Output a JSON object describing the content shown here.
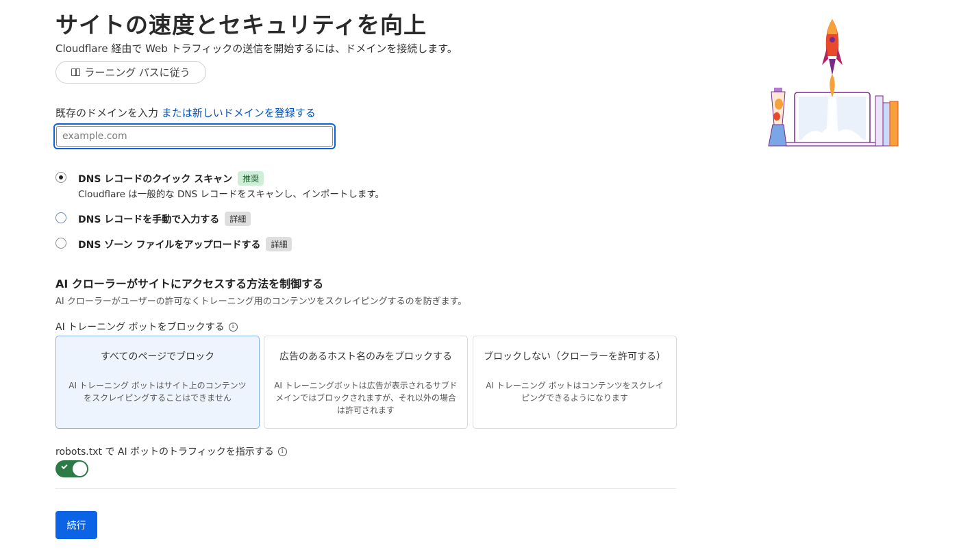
{
  "header": {
    "title": "サイトの速度とセキュリティを向上",
    "subtitle": "Cloudflare 経由で Web トラフィックの送信を開始するには、ドメインを接続します。",
    "learning_path_label": "ラーニング パスに従う"
  },
  "domain": {
    "label": "既存のドメインを入力",
    "register_link": "または新しいドメインを登録する",
    "placeholder": "example.com",
    "value": ""
  },
  "dns_options": [
    {
      "title": "DNS レコードのクイック スキャン",
      "badge": "推奨",
      "description": "Cloudflare は一般的な DNS レコードをスキャンし、インポートします。",
      "selected": true
    },
    {
      "title": "DNS レコードを手動で入力する",
      "badge": "詳細",
      "selected": false
    },
    {
      "title": "DNS ゾーン ファイルをアップロードする",
      "badge": "詳細",
      "selected": false
    }
  ],
  "ai_crawlers": {
    "title": "AI クローラーがサイトにアクセスする方法を制御する",
    "description": "AI クローラーがユーザーの許可なくトレーニング用のコンテンツをスクレイピングするのを防ぎます。",
    "block_label": "AI トレーニング ボットをブロックする",
    "cards": [
      {
        "title": "すべてのページでブロック",
        "description": "AI トレーニング ボットはサイト上のコンテンツをスクレイピングすることはできません",
        "selected": true
      },
      {
        "title": "広告のあるホスト名のみをブロックする",
        "description": "AI トレーニングボットは広告が表示されるサブドメインではブロックされますが、それ以外の場合は許可されます",
        "selected": false
      },
      {
        "title": "ブロックしない（クローラーを許可する）",
        "description": "AI トレーニング ボットはコンテンツをスクレイピングできるようになります",
        "selected": false
      }
    ],
    "robots_label": "robots.txt で AI ボットのトラフィックを指示する",
    "robots_enabled": true
  },
  "actions": {
    "continue_label": "続行"
  },
  "colors": {
    "primary": "#0b63e5",
    "link": "#0051c3",
    "toggle_on": "#2c7a45",
    "selected_card_bg": "#eef4fe",
    "badge_green": "#cfeed7"
  }
}
